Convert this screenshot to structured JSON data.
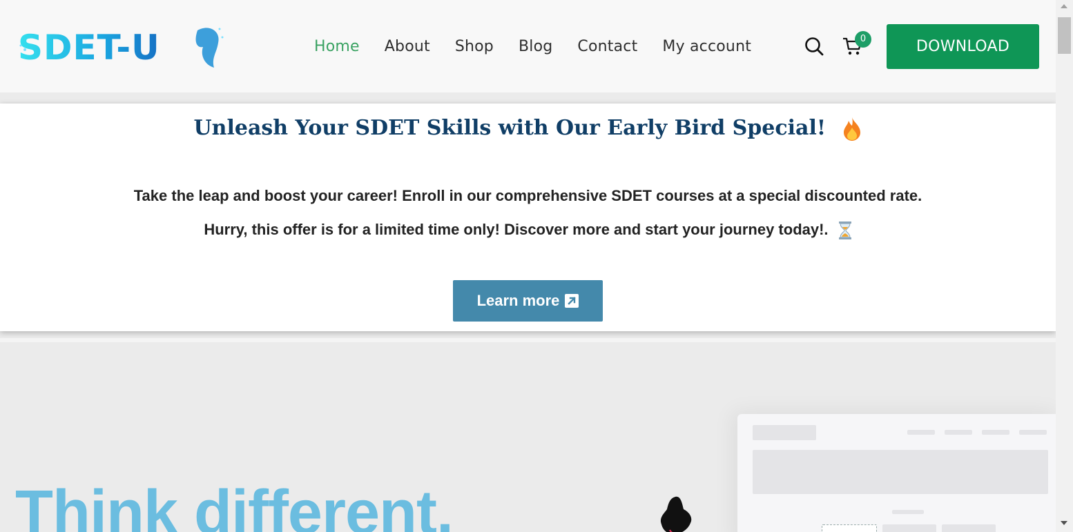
{
  "header": {
    "logo_text": "SDET-U",
    "nav": [
      {
        "label": "Home",
        "active": true
      },
      {
        "label": "About",
        "active": false
      },
      {
        "label": "Shop",
        "active": false
      },
      {
        "label": "Blog",
        "active": false
      },
      {
        "label": "Contact",
        "active": false
      },
      {
        "label": "My account",
        "active": false
      }
    ],
    "search_icon": "search-icon",
    "cart_icon": "cart-icon",
    "cart_count": "0",
    "download_label": "DOWNLOAD"
  },
  "promo": {
    "title": "Unleash Your SDET Skills with Our Early Bird Special!",
    "title_icon": "fire-emoji",
    "line1": "Take the leap and boost your career! Enroll in our comprehensive SDET courses at a special discounted rate.",
    "line2": "Hurry, this offer is for a limited time only! Discover more and start your journey today!.",
    "line2_icon": "hourglass-emoji",
    "button_label": "Learn more",
    "button_icon": "external-link-icon"
  },
  "hero": {
    "title": "Think different."
  },
  "colors": {
    "accent_green": "#3aa262",
    "download_green": "#0f9656",
    "title_navy": "#103e66",
    "button_blue": "#4489ab",
    "hero_blue": "#6bbde0"
  }
}
